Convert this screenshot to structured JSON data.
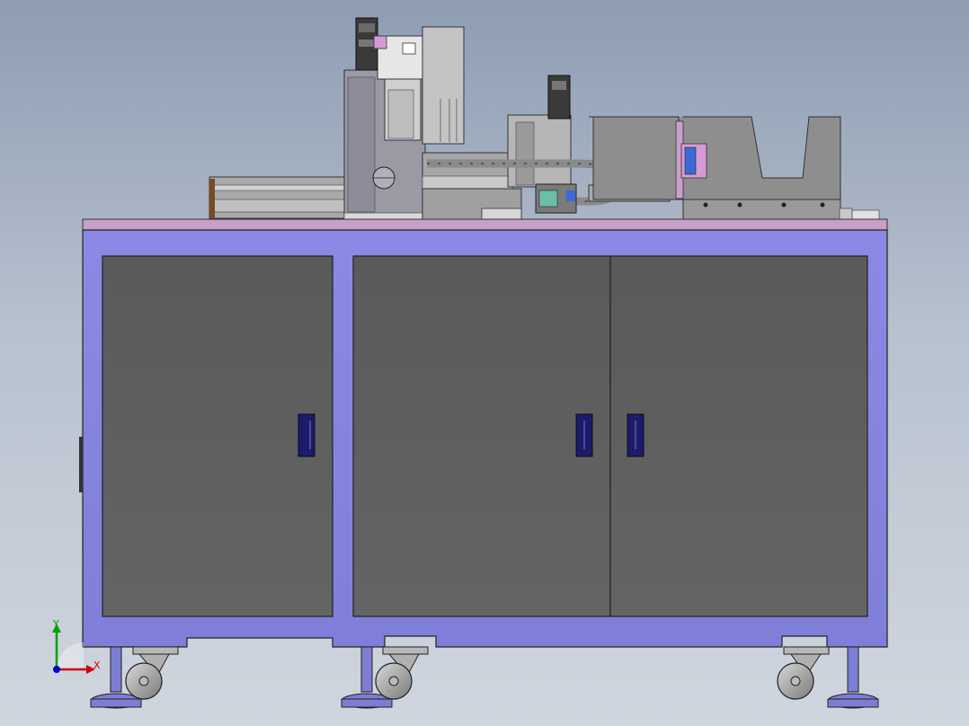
{
  "window": {
    "background_top": "#8e9db3",
    "background_bottom": "#d0d6de"
  },
  "model": {
    "frame_color": "#8585e0",
    "door_color": "#5f5f5f",
    "plate_color": "#c6a0c6",
    "handle_color": "#1c1c6a",
    "machine_gray": "#9a9a9a",
    "accent_pink": "#d59ad5",
    "accent_blue": "#3a6ad6"
  },
  "triad": {
    "x_label": "X",
    "y_label": "Y",
    "x_color": "#cc0000",
    "y_color": "#00a000",
    "z_color": "#0000cc"
  }
}
